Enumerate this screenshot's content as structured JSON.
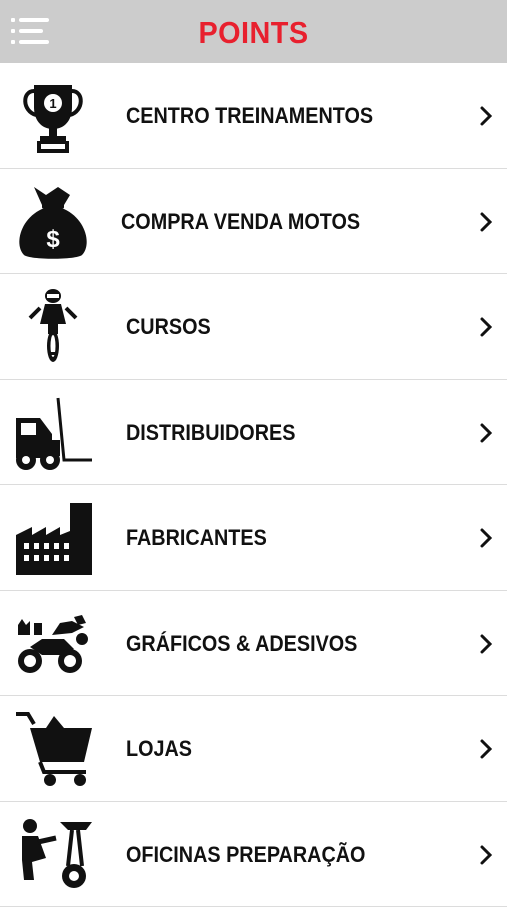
{
  "header": {
    "title": "POINTS",
    "menu_icon": "hamburger-menu-icon",
    "title_color": "#e8202e",
    "background": "#cccccc"
  },
  "items": [
    {
      "label": "CENTRO TREINAMENTOS",
      "icon": "trophy-icon"
    },
    {
      "label": "COMPRA VENDA MOTOS",
      "icon": "money-bag-icon"
    },
    {
      "label": "CURSOS",
      "icon": "motorcycle-rider-icon"
    },
    {
      "label": "DISTRIBUIDORES",
      "icon": "forklift-icon"
    },
    {
      "label": "FABRICANTES",
      "icon": "factory-icon"
    },
    {
      "label": "GRÁFICOS & ADESIVOS",
      "icon": "motorcycle-graphics-icon"
    },
    {
      "label": "LOJAS",
      "icon": "shopping-cart-icon"
    },
    {
      "label": "OFICINAS PREPARAÇÃO",
      "icon": "mechanic-icon"
    }
  ]
}
